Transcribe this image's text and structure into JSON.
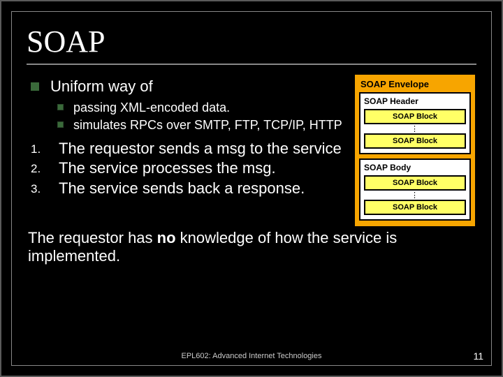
{
  "title": "SOAP",
  "bullet1": "Uniform way of",
  "sub": [
    "passing XML-encoded data.",
    "simulates RPCs over SMTP, FTP, TCP/IP, HTTP"
  ],
  "numbered": [
    "The requestor sends a msg to the service",
    "The service processes the msg.",
    "The service sends back a response."
  ],
  "closing_pre": "The requestor has ",
  "closing_bold": "no",
  "closing_post": " knowledge of how the service is implemented.",
  "diagram": {
    "envelope": "SOAP Envelope",
    "header": "SOAP Header",
    "body": "SOAP Body",
    "block": "SOAP Block"
  },
  "footer": "EPL602: Advanced Internet Technologies",
  "page": "11",
  "nums": {
    "n1": "1.",
    "n2": "2.",
    "n3": "3."
  }
}
